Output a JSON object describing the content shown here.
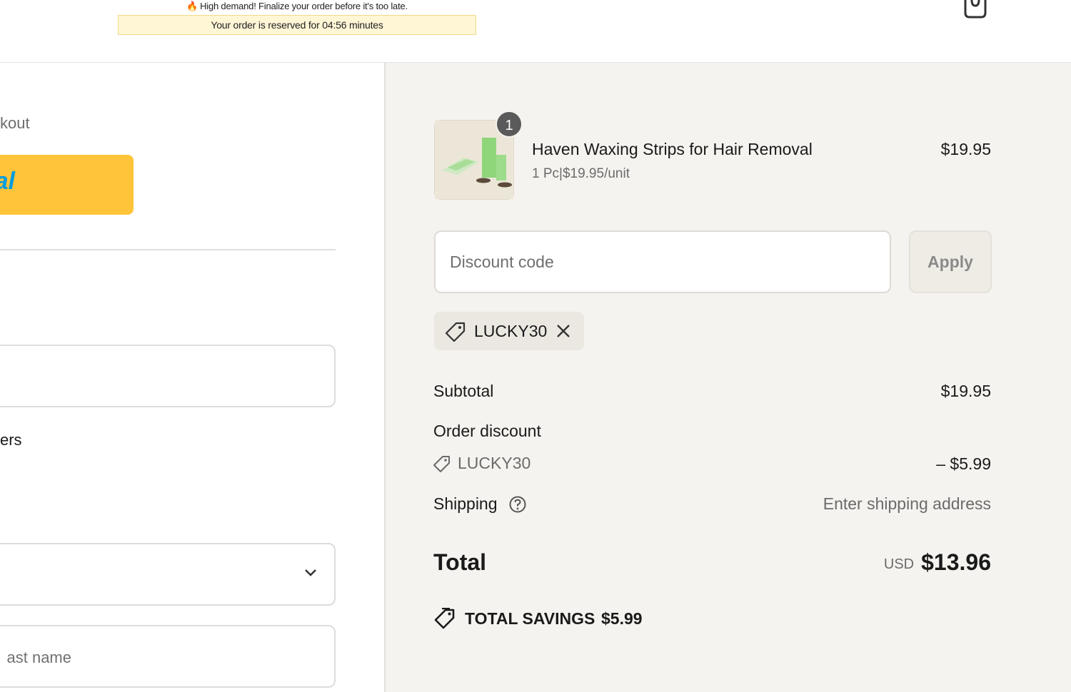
{
  "header": {
    "urgency_message": "High demand! Finalize your order before it's too late.",
    "reservation_message": "Your order is reserved for 04:56 minutes"
  },
  "left": {
    "express_checkout_partial": "kout",
    "paypal_partial": "al",
    "offers_partial": "ers",
    "last_name_placeholder_partial": "ast name"
  },
  "product": {
    "name": "Haven Waxing Strips for Hair Removal",
    "unit_info": "1 Pc|$19.95/unit",
    "price": "$19.95",
    "quantity": "1"
  },
  "discount": {
    "placeholder": "Discount code",
    "apply_label": "Apply",
    "applied_code": "LUCKY30"
  },
  "summary": {
    "subtotal_label": "Subtotal",
    "subtotal_value": "$19.95",
    "order_discount_label": "Order discount",
    "discount_code": "LUCKY30",
    "discount_value": "– $5.99",
    "shipping_label": "Shipping",
    "shipping_value": "Enter shipping address",
    "total_label": "Total",
    "currency": "USD",
    "total_value": "$13.96",
    "savings_label": "TOTAL SAVINGS",
    "savings_value": "$5.99"
  },
  "icons": {
    "fire": "fire-icon",
    "cart": "shopping-bag-icon",
    "tag": "tag-icon",
    "close": "close-icon",
    "help": "help-circle-icon",
    "chevron": "chevron-down-icon"
  },
  "colors": {
    "paypal_yellow": "#ffc439",
    "summary_background": "#f5f3ef",
    "reserve_background": "#fff6d6"
  }
}
